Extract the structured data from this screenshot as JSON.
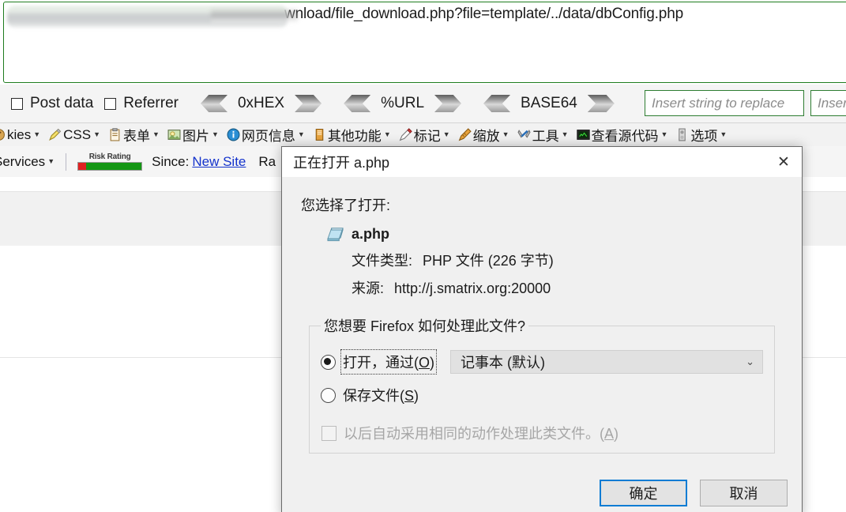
{
  "urlbar": {
    "visible_url": "wnload/file_download.php?file=template/../data/dbConfig.php",
    "redacted": true
  },
  "toolbar_primary": {
    "checkboxes": [
      {
        "label": "Post data",
        "checked": false
      },
      {
        "label": "Referrer",
        "checked": false
      }
    ],
    "encoders": [
      {
        "label": "0xHEX"
      },
      {
        "label": "%URL"
      },
      {
        "label": "BASE64"
      }
    ],
    "inputs": [
      {
        "placeholder": "Insert string to replace",
        "value": ""
      },
      {
        "placeholder": "Insert",
        "value": ""
      }
    ]
  },
  "toolbar_devmenu": {
    "items": [
      {
        "label": "kies",
        "icon": "cookie-icon",
        "truncated": true
      },
      {
        "label": "CSS",
        "icon": "css-pencil-icon"
      },
      {
        "label": "表单",
        "icon": "form-clipboard-icon"
      },
      {
        "label": "图片",
        "icon": "images-picture-icon"
      },
      {
        "label": "网页信息",
        "icon": "page-info-icon"
      },
      {
        "label": "其他功能",
        "icon": "misc-icon"
      },
      {
        "label": "标记",
        "icon": "outline-pencil-icon"
      },
      {
        "label": "缩放",
        "icon": "resize-ruler-icon"
      },
      {
        "label": "工具",
        "icon": "tools-wrench-icon"
      },
      {
        "label": "查看源代码",
        "icon": "view-source-icon"
      },
      {
        "label": "选项",
        "icon": "options-icon"
      }
    ]
  },
  "toolbar_wot": {
    "services_label": "Services",
    "risk_rating_label": "Risk Rating",
    "since_label": "Since:",
    "since_link": "New Site",
    "since_trailing": "Ra"
  },
  "dialog": {
    "title": "正在打开 a.php",
    "close_icon": "close-icon",
    "chose_line": "您选择了打开:",
    "file_icon": "notepad-file-icon",
    "file_name": "a.php",
    "meta": [
      {
        "key": "文件类型:",
        "value": "PHP 文件 (226 字节)"
      },
      {
        "key": "来源:",
        "value": "http://j.smatrix.org:20000"
      }
    ],
    "how_legend": "您想要 Firefox 如何处理此文件?",
    "options": [
      {
        "label_prefix": "打开，通过(",
        "accel": "O",
        "label_suffix": ")",
        "checked": true,
        "focused": true
      },
      {
        "label_prefix": "保存文件(",
        "accel": "S",
        "label_suffix": ")",
        "checked": false,
        "focused": false
      }
    ],
    "combo": {
      "value": "记事本 (默认)",
      "arrow_icon": "chevron-down-icon"
    },
    "remember": {
      "label_prefix": "以后自动采用相同的动作处理此类文件。(",
      "accel": "A",
      "label_suffix": ")",
      "checked": false,
      "disabled": true
    },
    "buttons": {
      "ok": "确定",
      "cancel": "取消"
    }
  },
  "colors": {
    "url_border": "#1e7c1e",
    "input_border": "#2e7d32",
    "focus_blue": "#0a7cd4",
    "link_blue": "#1433cc",
    "risk_green": "#149614",
    "risk_red": "#e02121"
  }
}
